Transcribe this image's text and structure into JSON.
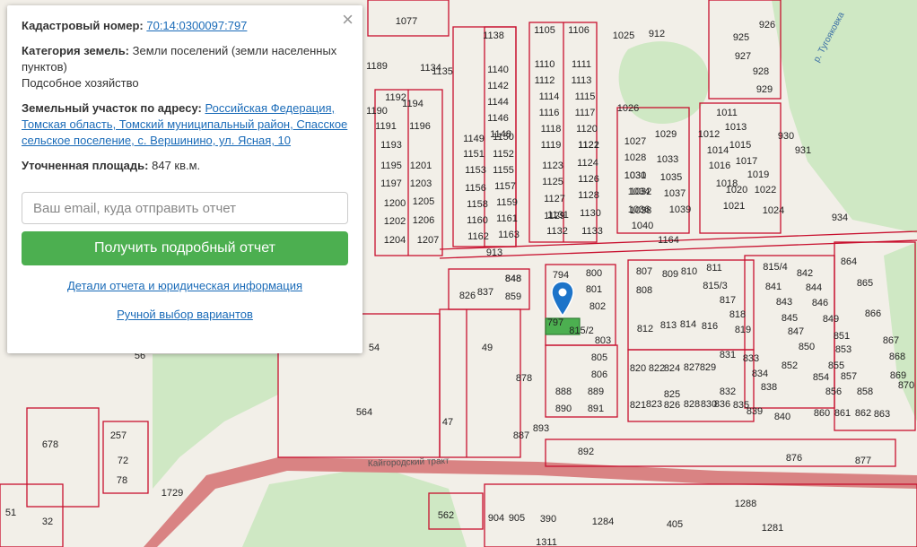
{
  "popup": {
    "close_label": "×",
    "cadastral_label": "Кадастровый номер:",
    "cadastral_value": "70:14:0300097:797",
    "category_label": "Категория земель:",
    "category_value": "Земли поселений (земли населенных пунктов)",
    "usage_value": "Подсобное хозяйство",
    "address_label": "Земельный участок по адресу:",
    "address_value": "Российская Федерация, Томская область, Томский муниципальный район, Спасское сельское поселение, с. Вершинино, ул. Ясная, 10",
    "area_label": "Уточненная площадь:",
    "area_value": "847 кв.м.",
    "email_placeholder": "Ваш email, куда отправить отчет",
    "submit_label": "Получить подробный отчет",
    "details_link": "Детали отчета и юридическая информация",
    "manual_link": "Ручной выбор вариантов"
  },
  "map": {
    "river_label": "р. Тугояковка",
    "road_label": "Кайгородский тракт",
    "selected_parcel": "797",
    "parcels": [
      "1077",
      "1138",
      "1105",
      "1106",
      "1025",
      "912",
      "926",
      "925",
      "927",
      "928",
      "929",
      "1189",
      "1135",
      "1134",
      "1140",
      "1110",
      "1111",
      "1142",
      "1112",
      "1113",
      "1190",
      "1192",
      "1194",
      "1144",
      "1114",
      "1115",
      "1146",
      "1116",
      "1117",
      "1026",
      "1011",
      "1013",
      "930",
      "1191",
      "1193",
      "1196",
      "1148",
      "1118",
      "1120",
      "1012",
      "1014",
      "1015",
      "1149",
      "1150",
      "1119",
      "1121",
      "1122",
      "1027",
      "1029",
      "1016",
      "1017",
      "1195",
      "1201",
      "1151",
      "1152",
      "1123",
      "1124",
      "1028",
      "1030",
      "1018",
      "1019",
      "931",
      "1197",
      "1203",
      "1153",
      "1155",
      "1125",
      "1126",
      "1031",
      "1033",
      "1020",
      "1022",
      "1200",
      "1205",
      "1156",
      "1157",
      "1127",
      "1128",
      "1032",
      "1035",
      "1021",
      "1024",
      "1202",
      "1206",
      "1158",
      "1159",
      "1129",
      "1130",
      "1034",
      "1037",
      "1204",
      "1207",
      "1160",
      "1161",
      "1131",
      "1133",
      "1036",
      "1039",
      "934",
      "1162",
      "1163",
      "1132",
      "1038",
      "1040",
      "1164",
      "913",
      "848",
      "794",
      "800",
      "807",
      "809",
      "811",
      "815/4",
      "842",
      "864",
      "865",
      "826",
      "837",
      "859",
      "801",
      "808",
      "810",
      "815/3",
      "841",
      "844",
      "802",
      "817",
      "843",
      "846",
      "866",
      "818",
      "845",
      "848",
      "797",
      "815/2",
      "812",
      "813",
      "814",
      "816",
      "819",
      "847",
      "849",
      "867",
      "803",
      "820",
      "822",
      "824",
      "827",
      "829",
      "831",
      "850",
      "851",
      "868",
      "805",
      "821",
      "823",
      "826",
      "828",
      "830",
      "833",
      "852",
      "853",
      "869",
      "806",
      "834",
      "854",
      "855",
      "887",
      "888",
      "889",
      "825",
      "832",
      "835",
      "836",
      "838",
      "856",
      "857",
      "858",
      "870",
      "878",
      "890",
      "891",
      "839",
      "840",
      "860",
      "861",
      "862",
      "863",
      "564",
      "47",
      "49",
      "893",
      "892",
      "876",
      "877",
      "1288",
      "1281",
      "1284",
      "905",
      "904",
      "562",
      "390",
      "405",
      "1311",
      "678",
      "257",
      "72",
      "78",
      "54",
      "56",
      "51",
      "32",
      "1729"
    ]
  }
}
